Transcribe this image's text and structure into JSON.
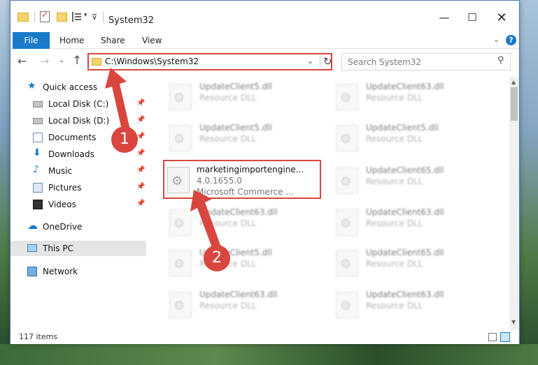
{
  "window": {
    "title": "System32",
    "controls": {
      "minimize": "—",
      "maximize": "☐",
      "close": "✕"
    }
  },
  "ribbon": {
    "tabs": {
      "file": "File",
      "home": "Home",
      "share": "Share",
      "view": "View"
    },
    "help": "?"
  },
  "address": {
    "path": "C:\\Windows\\System32"
  },
  "search": {
    "placeholder": "Search System32"
  },
  "sidebar": {
    "quick_access": "Quick access",
    "items": [
      {
        "label": "Local Disk (C:)"
      },
      {
        "label": "Local Disk (D:)"
      },
      {
        "label": "Documents"
      },
      {
        "label": "Downloads"
      },
      {
        "label": "Music"
      },
      {
        "label": "Pictures"
      },
      {
        "label": "Videos"
      }
    ],
    "onedrive": "OneDrive",
    "this_pc": "This PC",
    "network": "Network"
  },
  "files": {
    "tiles": [
      {
        "name": "UpdateClient5.dll",
        "desc": "Resource DLL"
      },
      {
        "name": "UpdateClient63.dll",
        "desc": "Resource DLL"
      },
      {
        "name": "UpdateClient5.dll",
        "desc": "Resource DLL"
      },
      {
        "name": "UpdateClient5.dll",
        "desc": "Resource DLL"
      },
      {
        "name": "UpdateClient65.dll",
        "desc": "Resource DLL"
      },
      {
        "name": "UpdateClient63.dll",
        "desc": "Resource DLL"
      },
      {
        "name": "UpdateClient63.dll",
        "desc": "Resource DLL"
      },
      {
        "name": "UpdateClient5.dll",
        "desc": "Resource DLL"
      },
      {
        "name": "UpdateClient65.dll",
        "desc": "Resource DLL"
      },
      {
        "name": "UpdateClient63.dll",
        "desc": "Resource DLL"
      },
      {
        "name": "UpdateClient63.dll",
        "desc": "Resource DLL"
      }
    ],
    "highlighted": {
      "name": "marketingimportengine...",
      "version": "4.0.1655.0",
      "company": "Microsoft Commerce ..."
    }
  },
  "status": {
    "item_count": "117 items"
  },
  "annotations": {
    "badge1": "1",
    "badge2": "2",
    "color": "#d9463f"
  }
}
